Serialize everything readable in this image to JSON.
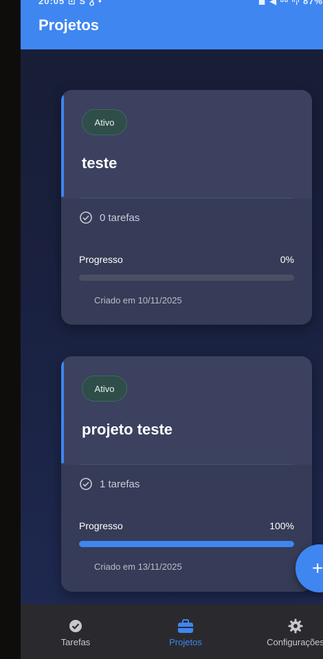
{
  "status_bar": {
    "time": "20:05 ⊡ S ᵹ •",
    "indicators": "◼ ◀ ᵈᵈ ⁿᵢˡ 87%"
  },
  "app_bar": {
    "title": "Projetos"
  },
  "projects": [
    {
      "status": "Ativo",
      "name": "teste",
      "tasks": "0 tarefas",
      "progress_label": "Progresso",
      "progress_value": "0%",
      "progress_fraction": 0,
      "created": "Criado em 10/11/2025"
    },
    {
      "status": "Ativo",
      "name": "projeto teste",
      "tasks": "1 tarefas",
      "progress_label": "Progresso",
      "progress_value": "100%",
      "progress_fraction": 1,
      "created": "Criado em 13/11/2025"
    }
  ],
  "fab": {
    "icon": "plus-icon",
    "label": "+"
  },
  "bottom_nav": {
    "items": [
      {
        "label": "Tarefas",
        "icon": "check-circle-icon",
        "active": false
      },
      {
        "label": "Projetos",
        "icon": "briefcase-icon",
        "active": true
      },
      {
        "label": "Configurações",
        "icon": "gear-icon",
        "active": false
      }
    ]
  },
  "colors": {
    "accent": "#3f86f0",
    "badge_bg": "#2f4d49",
    "card_bg": "#363c57",
    "nav_bg": "#2a2a2e"
  }
}
